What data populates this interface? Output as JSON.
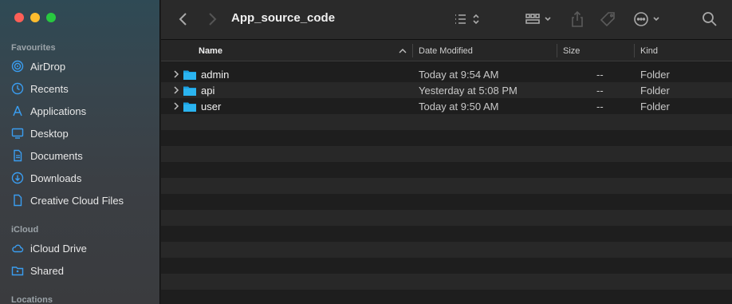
{
  "window": {
    "title": "App_source_code"
  },
  "sidebar": {
    "favourites_title": "Favourites",
    "favourites": [
      {
        "label": "AirDrop",
        "icon": "airdrop-icon"
      },
      {
        "label": "Recents",
        "icon": "clock-icon"
      },
      {
        "label": "Applications",
        "icon": "applications-icon"
      },
      {
        "label": "Desktop",
        "icon": "desktop-icon"
      },
      {
        "label": "Documents",
        "icon": "document-icon"
      },
      {
        "label": "Downloads",
        "icon": "download-icon"
      },
      {
        "label": "Creative Cloud Files",
        "icon": "file-icon"
      }
    ],
    "icloud_title": "iCloud",
    "icloud": [
      {
        "label": "iCloud Drive",
        "icon": "cloud-icon"
      },
      {
        "label": "Shared",
        "icon": "shared-folder-icon"
      }
    ],
    "locations_title": "Locations"
  },
  "columns": {
    "name": "Name",
    "date": "Date Modified",
    "size": "Size",
    "kind": "Kind"
  },
  "files": [
    {
      "name": "admin",
      "date": "Today at 9:54 AM",
      "size": "--",
      "kind": "Folder"
    },
    {
      "name": "api",
      "date": "Yesterday at 5:08 PM",
      "size": "--",
      "kind": "Folder"
    },
    {
      "name": "user",
      "date": "Today at 9:50 AM",
      "size": "--",
      "kind": "Folder"
    }
  ],
  "colors": {
    "accent": "#3a9df0",
    "folder": "#1ba1e2"
  }
}
